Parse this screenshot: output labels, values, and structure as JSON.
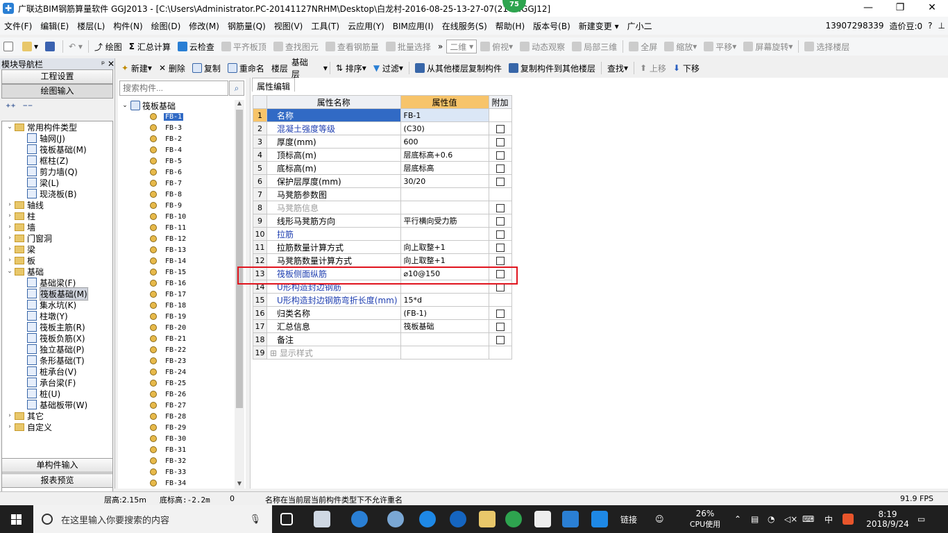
{
  "window": {
    "title": "广联达BIM钢筋算量软件 GGJ2013 - [C:\\Users\\Administrator.PC-20141127NRHM\\Desktop\\白龙村-2016-08-25-13-27-07(216...GGJ12]",
    "badge": "75",
    "min": "—",
    "max": "❐",
    "close": "✕"
  },
  "menu": {
    "items": [
      "文件(F)",
      "编辑(E)",
      "楼层(L)",
      "构件(N)",
      "绘图(D)",
      "修改(M)",
      "钢筋量(Q)",
      "视图(V)",
      "工具(T)",
      "云应用(Y)",
      "BIM应用(I)",
      "在线服务(S)",
      "帮助(H)",
      "版本号(B)",
      "新建变更 ▾",
      "广小二"
    ],
    "phone": "13907298339",
    "coins": "造价豆:0"
  },
  "toolbar1": {
    "draw": "绘图",
    "summary": "汇总计算",
    "cloud_check": "云检查",
    "align_top": "平齐板顶",
    "find_elem": "查找图元",
    "view_rebar": "查看钢筋量",
    "batch_select": "批量选择",
    "view2d": "二维",
    "top_view": "俯视",
    "dynamic_view": "动态观察",
    "local3d": "局部三维",
    "fullscreen": "全屏",
    "zoom": "缩放",
    "pan": "平移",
    "rotate": "屏幕旋转",
    "select_floor": "选择楼层"
  },
  "nav": {
    "header": "模块导航栏",
    "btn_project": "工程设置",
    "btn_draw": "绘图输入",
    "btn_single": "单构件输入",
    "btn_report": "报表预览",
    "tree": [
      {
        "indent": 0,
        "exp": "⌄",
        "folder": true,
        "label": "常用构件类型"
      },
      {
        "indent": 1,
        "label": "轴网(J)"
      },
      {
        "indent": 1,
        "label": "筏板基础(M)"
      },
      {
        "indent": 1,
        "label": "框柱(Z)"
      },
      {
        "indent": 1,
        "label": "剪力墙(Q)"
      },
      {
        "indent": 1,
        "label": "梁(L)"
      },
      {
        "indent": 1,
        "label": "现浇板(B)"
      },
      {
        "indent": 0,
        "exp": "›",
        "folder": true,
        "label": "轴线"
      },
      {
        "indent": 0,
        "exp": "›",
        "folder": true,
        "label": "柱"
      },
      {
        "indent": 0,
        "exp": "›",
        "folder": true,
        "label": "墙"
      },
      {
        "indent": 0,
        "exp": "›",
        "folder": true,
        "label": "门窗洞"
      },
      {
        "indent": 0,
        "exp": "›",
        "folder": true,
        "label": "梁"
      },
      {
        "indent": 0,
        "exp": "›",
        "folder": true,
        "label": "板"
      },
      {
        "indent": 0,
        "exp": "⌄",
        "folder": true,
        "label": "基础"
      },
      {
        "indent": 1,
        "label": "基础梁(F)"
      },
      {
        "indent": 1,
        "label": "筏板基础(M)",
        "selected": true
      },
      {
        "indent": 1,
        "label": "集水坑(K)"
      },
      {
        "indent": 1,
        "label": "柱墩(Y)"
      },
      {
        "indent": 1,
        "label": "筏板主筋(R)"
      },
      {
        "indent": 1,
        "label": "筏板负筋(X)"
      },
      {
        "indent": 1,
        "label": "独立基础(P)"
      },
      {
        "indent": 1,
        "label": "条形基础(T)"
      },
      {
        "indent": 1,
        "label": "桩承台(V)"
      },
      {
        "indent": 1,
        "label": "承台梁(F)"
      },
      {
        "indent": 1,
        "label": "桩(U)"
      },
      {
        "indent": 1,
        "label": "基础板带(W)"
      },
      {
        "indent": 0,
        "exp": "›",
        "folder": true,
        "label": "其它"
      },
      {
        "indent": 0,
        "exp": "›",
        "folder": true,
        "label": "自定义"
      }
    ]
  },
  "toolbar2": {
    "new": "新建",
    "delete": "删除",
    "copy": "复制",
    "rename": "重命名",
    "floor_label": "楼层",
    "floor_value": "基础层",
    "sort": "排序",
    "filter": "过滤",
    "copy_from": "从其他楼层复制构件",
    "copy_to": "复制构件到其他楼层",
    "find": "查找",
    "move_up": "上移",
    "move_down": "下移"
  },
  "complist": {
    "search_placeholder": "搜索构件...",
    "parent": "筏板基础",
    "items": [
      "FB-1",
      "FB-3",
      "FB-2",
      "FB-4",
      "FB-5",
      "FB-6",
      "FB-7",
      "FB-8",
      "FB-9",
      "FB-10",
      "FB-11",
      "FB-12",
      "FB-13",
      "FB-14",
      "FB-15",
      "FB-16",
      "FB-17",
      "FB-18",
      "FB-19",
      "FB-20",
      "FB-21",
      "FB-22",
      "FB-23",
      "FB-24",
      "FB-25",
      "FB-26",
      "FB-27",
      "FB-28",
      "FB-29",
      "FB-30",
      "FB-31",
      "FB-32",
      "FB-33",
      "FB-34"
    ]
  },
  "props": {
    "tab": "属性编辑",
    "col_name": "属性名称",
    "col_value": "属性值",
    "col_add": "附加",
    "rows": [
      {
        "n": "1",
        "name": "名称",
        "value": "FB-1",
        "style": "selrow",
        "cb": false
      },
      {
        "n": "2",
        "name": "混凝土强度等级",
        "value": "(C30)",
        "style": "blue",
        "cb": true
      },
      {
        "n": "3",
        "name": "厚度(mm)",
        "value": "600",
        "style": "",
        "cb": true
      },
      {
        "n": "4",
        "name": "顶标高(m)",
        "value": "层底标高+0.6",
        "style": "",
        "cb": true
      },
      {
        "n": "5",
        "name": "底标高(m)",
        "value": "层底标高",
        "style": "",
        "cb": true
      },
      {
        "n": "6",
        "name": "保护层厚度(mm)",
        "value": "30/20",
        "style": "",
        "cb": true
      },
      {
        "n": "7",
        "name": "马凳筋参数图",
        "value": "",
        "style": "",
        "cb": false
      },
      {
        "n": "8",
        "name": "马凳筋信息",
        "value": "",
        "style": "gray",
        "cb": true
      },
      {
        "n": "9",
        "name": "线形马凳筋方向",
        "value": "平行横向受力筋",
        "style": "",
        "cb": true
      },
      {
        "n": "10",
        "name": "拉筋",
        "value": "",
        "style": "blue",
        "cb": true
      },
      {
        "n": "11",
        "name": "拉筋数量计算方式",
        "value": "向上取整+1",
        "style": "",
        "cb": true
      },
      {
        "n": "12",
        "name": "马凳筋数量计算方式",
        "value": "向上取整+1",
        "style": "",
        "cb": true
      },
      {
        "n": "13",
        "name": "筏板侧面纵筋",
        "value": "⌀10@150",
        "style": "blue",
        "cb": true
      },
      {
        "n": "14",
        "name": "U形构造封边钢筋",
        "value": "",
        "style": "blue",
        "cb": true
      },
      {
        "n": "15",
        "name": "U形构造封边钢筋弯折长度(mm)",
        "value": "15*d",
        "style": "blue",
        "cb": false
      },
      {
        "n": "16",
        "name": "归类名称",
        "value": "(FB-1)",
        "style": "",
        "cb": true
      },
      {
        "n": "17",
        "name": "汇总信息",
        "value": "筏板基础",
        "style": "",
        "cb": true
      },
      {
        "n": "18",
        "name": "备注",
        "value": "",
        "style": "",
        "cb": true
      },
      {
        "n": "19",
        "name": "显示样式",
        "value": "",
        "style": "gray",
        "cb": false,
        "plus": true
      }
    ]
  },
  "status": {
    "floor_height": "层高:2.15m",
    "floor_bottom": "底标高:-2.2m",
    "zero": "0",
    "message": "名称在当前层当前构件类型下不允许重名",
    "fps": "91.9 FPS"
  },
  "taskbar": {
    "search_text": "在这里输入你要搜索的内容",
    "link": "链接",
    "cpu_pct": "26%",
    "cpu_label": "CPU使用",
    "ime": "中",
    "time": "8:19",
    "date": "2018/9/24"
  },
  "colors": {
    "accent": "#316ac5",
    "highlight_box": "#e0141e",
    "value_header": "#f7c46a"
  }
}
